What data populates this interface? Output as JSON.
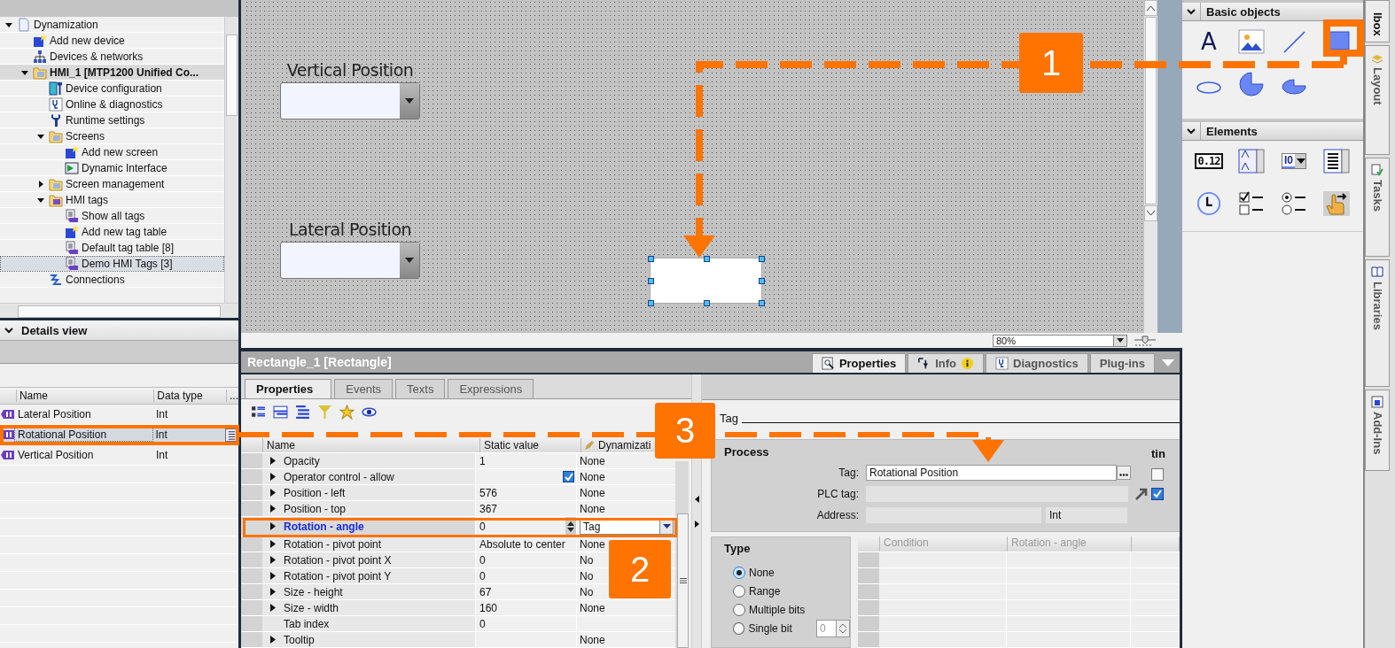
{
  "project_tree": {
    "items": [
      {
        "label": "Dynamization",
        "kind": "document",
        "expanded": true,
        "selected": false,
        "emphasized": false,
        "children": [
          {
            "label": "Add new device",
            "kind": "add",
            "selected": false,
            "emphasized": false
          },
          {
            "label": "Devices & networks",
            "kind": "network",
            "selected": false,
            "emphasized": false
          },
          {
            "label": "HMI_1 [MTP1200 Unified Co...",
            "kind": "device-folder",
            "expanded": true,
            "selected": false,
            "emphasized": true,
            "children": [
              {
                "label": "Device configuration",
                "kind": "tool",
                "selected": false,
                "emphasized": false
              },
              {
                "label": "Online & diagnostics",
                "kind": "diagnostics",
                "selected": false,
                "emphasized": false
              },
              {
                "label": "Runtime settings",
                "kind": "wrench",
                "selected": false,
                "emphasized": false
              },
              {
                "label": "Screens",
                "kind": "folder",
                "expanded": true,
                "selected": false,
                "emphasized": false,
                "children": [
                  {
                    "label": "Add new screen",
                    "kind": "add",
                    "selected": false,
                    "emphasized": false
                  },
                  {
                    "label": "Dynamic Interface",
                    "kind": "screen",
                    "selected": false,
                    "emphasized": false
                  }
                ]
              },
              {
                "label": "Screen management",
                "kind": "folder",
                "expanded": false,
                "selected": false,
                "emphasized": false
              },
              {
                "label": "HMI tags",
                "kind": "tag-folder",
                "expanded": true,
                "selected": false,
                "emphasized": false,
                "children": [
                  {
                    "label": "Show all tags",
                    "kind": "tags",
                    "selected": false,
                    "emphasized": false
                  },
                  {
                    "label": "Add new tag table",
                    "kind": "add",
                    "selected": false,
                    "emphasized": false
                  },
                  {
                    "label": "Default tag table [8]",
                    "kind": "tags",
                    "selected": false,
                    "emphasized": false
                  },
                  {
                    "label": "Demo HMI Tags [3]",
                    "kind": "tags",
                    "selected": true,
                    "emphasized": false
                  }
                ]
              },
              {
                "label": "Connections",
                "kind": "connections",
                "selected": false,
                "emphasized": false
              }
            ]
          }
        ]
      }
    ]
  },
  "details_view": {
    "title": "Details view",
    "columns": [
      "Name",
      "Data type",
      "..."
    ],
    "rows": [
      {
        "name": "Lateral Position",
        "data_type": "Int",
        "selected": false
      },
      {
        "name": "Rotational Position",
        "data_type": "Int",
        "selected": true
      },
      {
        "name": "Vertical Position",
        "data_type": "Int",
        "selected": false
      }
    ]
  },
  "canvas": {
    "labels": [
      "Vertical Position",
      "Lateral Position"
    ],
    "zoom": "80%"
  },
  "inspector": {
    "title": "Rectangle_1 [Rectangle]",
    "top_tabs": [
      {
        "label": "Properties",
        "selected": true
      },
      {
        "label": "Info",
        "selected": false
      },
      {
        "label": "Diagnostics",
        "selected": false
      },
      {
        "label": "Plug-ins",
        "selected": false
      }
    ],
    "tabs": [
      {
        "label": "Properties",
        "selected": true
      },
      {
        "label": "Events",
        "selected": false
      },
      {
        "label": "Texts",
        "selected": false
      },
      {
        "label": "Expressions",
        "selected": false
      }
    ],
    "columns": [
      "Name",
      "Static value",
      "Dynamizati"
    ],
    "rows": [
      {
        "name": "Opacity",
        "value": "1",
        "dynamization": "None",
        "expandable": true,
        "selected": false
      },
      {
        "name": "Operator control - allow",
        "kind": "checkbox",
        "checked": true,
        "dynamization": "None",
        "expandable": true,
        "selected": false
      },
      {
        "name": "Position - left",
        "value": "576",
        "dynamization": "None",
        "expandable": true,
        "selected": false
      },
      {
        "name": "Position - top",
        "value": "367",
        "dynamization": "None",
        "expandable": true,
        "selected": false
      },
      {
        "name": "Rotation - angle",
        "value": "0",
        "dynamization": "Tag",
        "expandable": true,
        "selected": true
      },
      {
        "name": "Rotation - pivot point",
        "value": "Absolute to center",
        "dynamization": "None",
        "expandable": true,
        "selected": false
      },
      {
        "name": "Rotation - pivot point X",
        "value": "0",
        "dynamization": "No",
        "expandable": true,
        "selected": false
      },
      {
        "name": "Rotation - pivot point Y",
        "value": "0",
        "dynamization": "No",
        "expandable": true,
        "selected": false
      },
      {
        "name": "Size - height",
        "value": "67",
        "dynamization": "No",
        "expandable": true,
        "selected": false
      },
      {
        "name": "Size - width",
        "value": "160",
        "dynamization": "None",
        "expandable": true,
        "selected": false
      },
      {
        "name": "Tab index",
        "value": "0",
        "expandable": false,
        "selected": false
      },
      {
        "name": "Tooltip",
        "dynamization": "None",
        "expandable": true,
        "selected": false
      }
    ],
    "tag_section": {
      "title": "Tag",
      "group": "Process",
      "fields": [
        {
          "label": "Tag:",
          "value": "Rotational Position",
          "kind": "browse"
        },
        {
          "label": "PLC tag:",
          "kind": "link"
        },
        {
          "label": "Address:",
          "kind": "split",
          "value": "Int"
        }
      ],
      "cut_label": "tin",
      "checks": [
        {
          "checked": false
        },
        {
          "checked": true
        }
      ]
    },
    "type_group": {
      "title": "Type",
      "options": [
        {
          "label": "None",
          "selected": true
        },
        {
          "label": "Range",
          "selected": false
        },
        {
          "label": "Multiple bits",
          "selected": false
        },
        {
          "label": "Single bit",
          "selected": false,
          "spin": "0"
        }
      ]
    },
    "condition_table": {
      "columns": [
        "Condition",
        "Rotation - angle"
      ]
    }
  },
  "toolbox": {
    "sections": [
      {
        "title": "Basic objects",
        "expanded": true,
        "tools": [
          {
            "kind": "text",
            "label": "A"
          },
          {
            "kind": "image"
          },
          {
            "kind": "line"
          },
          {
            "kind": "rectangle"
          },
          {
            "kind": "ellipse"
          },
          {
            "kind": "circle"
          },
          {
            "kind": "segment"
          }
        ]
      },
      {
        "title": "Elements",
        "expanded": true,
        "tools": [
          {
            "kind": "io",
            "label": "0.12"
          },
          {
            "kind": "symbolic"
          },
          {
            "kind": "combo",
            "label": "I0"
          },
          {
            "kind": "list"
          },
          {
            "kind": "clock"
          },
          {
            "kind": "checkboxes"
          },
          {
            "kind": "radios"
          },
          {
            "kind": "button"
          }
        ]
      }
    ]
  },
  "side_tabs": [
    "lbox",
    "Layout",
    "Tasks",
    "Libraries",
    "Add-Ins"
  ],
  "annotations": [
    "1",
    "2",
    "3"
  ]
}
